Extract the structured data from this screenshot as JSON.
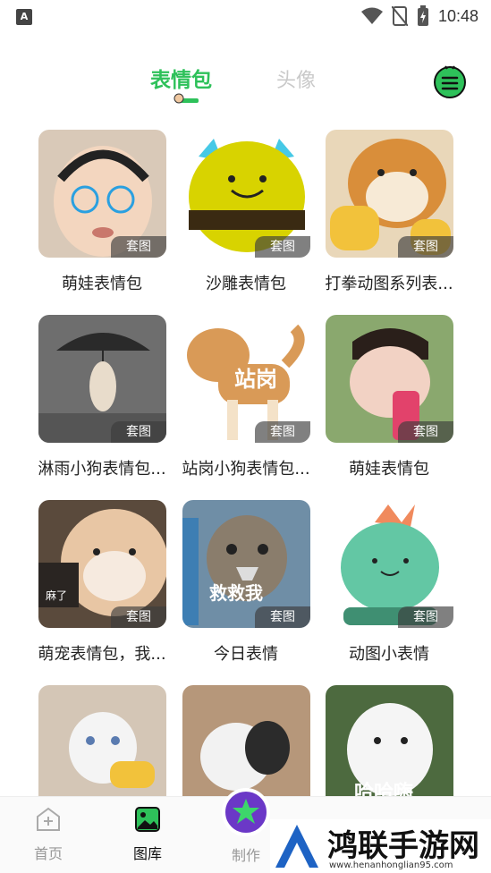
{
  "status_bar": {
    "time": "10:48",
    "left_icon_label": "A"
  },
  "header": {
    "tab_active": "表情包",
    "tab_inactive": "头像",
    "accent": "#2ec15a"
  },
  "badge_label": "套图",
  "cards": [
    {
      "caption": "萌娃表情包",
      "bg": "#d9c9b8",
      "accent": "#3a2a1f"
    },
    {
      "caption": "沙雕表情包",
      "bg": "#ffffff",
      "accent": "#d8d300"
    },
    {
      "caption": "打拳动图系列表...",
      "bg": "#e9d7b9",
      "accent": "#d98e3a"
    },
    {
      "caption": "淋雨小狗表情包...",
      "bg": "#6e6e6e",
      "accent": "#2a2a2a"
    },
    {
      "caption": "站岗小狗表情包...",
      "bg": "#ffffff",
      "accent": "#d99a57",
      "overlay_text": "站岗"
    },
    {
      "caption": "萌娃表情包",
      "bg": "#8aa86e",
      "accent": "#e7a3a0"
    },
    {
      "caption": "萌宠表情包，我...",
      "bg": "#5a4a3c",
      "accent": "#f1e8df",
      "overlay_text": "麻了"
    },
    {
      "caption": "今日表情",
      "bg": "#6f8ea6",
      "accent": "#8a7d6c",
      "overlay_text": "救救我"
    },
    {
      "caption": "动图小表情",
      "bg": "#ffffff",
      "accent": "#63c7a4"
    },
    {
      "caption": "",
      "bg": "#d4c6b6",
      "accent": "#f4f4f4"
    },
    {
      "caption": "",
      "bg": "#b6977a",
      "accent": "#f2f2f2"
    },
    {
      "caption": "",
      "bg": "#4d6a3f",
      "accent": "#f5f5f5",
      "overlay_text": "哈哈嗨"
    }
  ],
  "bottom_nav": {
    "items": [
      {
        "label": "首页",
        "icon": "home-plus-icon"
      },
      {
        "label": "图库",
        "icon": "gallery-icon"
      },
      {
        "label": "制作",
        "icon": "make-icon"
      }
    ]
  },
  "watermark": {
    "text": "鸿联手游网",
    "url": "www.henanhonglian95.com"
  }
}
